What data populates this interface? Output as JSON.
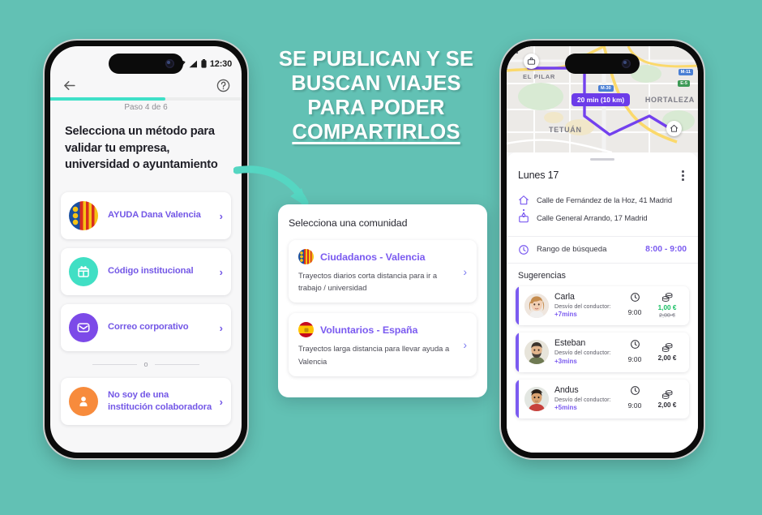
{
  "theme": {
    "background": "#62c1b4",
    "accent_purple": "#7b5bf0",
    "accent_teal": "#3fe0c8",
    "price_green": "#17bf63"
  },
  "headline": {
    "line1": "SE PUBLICAN Y SE",
    "line2": "BUSCAN VIAJES",
    "line3": "PARA PODER",
    "line4": "COMPARTIRLOS"
  },
  "left_phone": {
    "status_bar": {
      "time": "12:30",
      "icons": [
        "wifi-icon",
        "signal-icon",
        "battery-icon"
      ]
    },
    "back_icon": "back-arrow-icon",
    "help_icon": "help-circle-icon",
    "progress_percent": 60,
    "step_label": "Paso 4 de 6",
    "heading": "Selecciona un método para validar tu empresa, universidad o ayuntamiento",
    "options": [
      {
        "label": "AYUDA Dana Valencia",
        "icon": "valencia-flag-icon",
        "chevron": "›"
      },
      {
        "label": "Código institucional",
        "icon": "institution-code-icon",
        "chevron": "›"
      },
      {
        "label": "Correo corporativo",
        "icon": "envelope-icon",
        "chevron": "›"
      }
    ],
    "divider_text": "o",
    "fallback_option": {
      "label": "No soy de una institución colaboradora",
      "icon": "person-icon",
      "chevron": "›"
    }
  },
  "overlay": {
    "title": "Selecciona una comunidad",
    "communities": [
      {
        "name": "Ciudadanos - Valencia",
        "flag": "valencia-flag-icon",
        "description": "Trayectos diarios corta distancia para ir a trabajo / universidad",
        "chevron": "›"
      },
      {
        "name": "Voluntarios - España",
        "flag": "spain-flag-icon",
        "description": "Trayectos larga distancia para llevar ayuda a Valencia",
        "chevron": "›"
      }
    ]
  },
  "right_phone": {
    "status_bar": {
      "time": "",
      "icons": []
    },
    "map": {
      "back_icon": "back-arrow-icon",
      "work_pin_icon": "briefcase-pin-icon",
      "home_pin_icon": "home-pin-icon",
      "route_pill": "20 min (10 km)",
      "labels": [
        "EL PILAR",
        "TETUÁN",
        "HORTALEZA"
      ],
      "road_badges": [
        "M-30",
        "M-11",
        "E-5"
      ]
    },
    "date": "Lunes 17",
    "menu_icon": "kebab-menu-icon",
    "origin": {
      "icon": "home-icon",
      "address": "Calle de Fernández de la Hoz, 41 Madrid"
    },
    "destination": {
      "icon": "briefcase-icon",
      "address": "Calle General Arrando, 17 Madrid"
    },
    "range": {
      "icon": "clock-icon",
      "label": "Rango de búsqueda",
      "value": "8:00 - 9:00"
    },
    "suggestions_title": "Sugerencias",
    "suggestions": [
      {
        "name": "Carla",
        "deviation_label": "Desvío del conductor:",
        "deviation_value": "+7mins",
        "time": "9:00",
        "price": "1,00 €",
        "old_price": "2,00 €",
        "avatar": "avatar-carla"
      },
      {
        "name": "Esteban",
        "deviation_label": "Desvío del conductor:",
        "deviation_value": "+3mins",
        "time": "9:00",
        "price": "2,00 €",
        "old_price": "",
        "avatar": "avatar-esteban"
      },
      {
        "name": "Andus",
        "deviation_label": "Desvío del conductor:",
        "deviation_value": "+5mins",
        "time": "9:00",
        "price": "2,00 €",
        "old_price": "",
        "avatar": "avatar-andus"
      }
    ]
  }
}
